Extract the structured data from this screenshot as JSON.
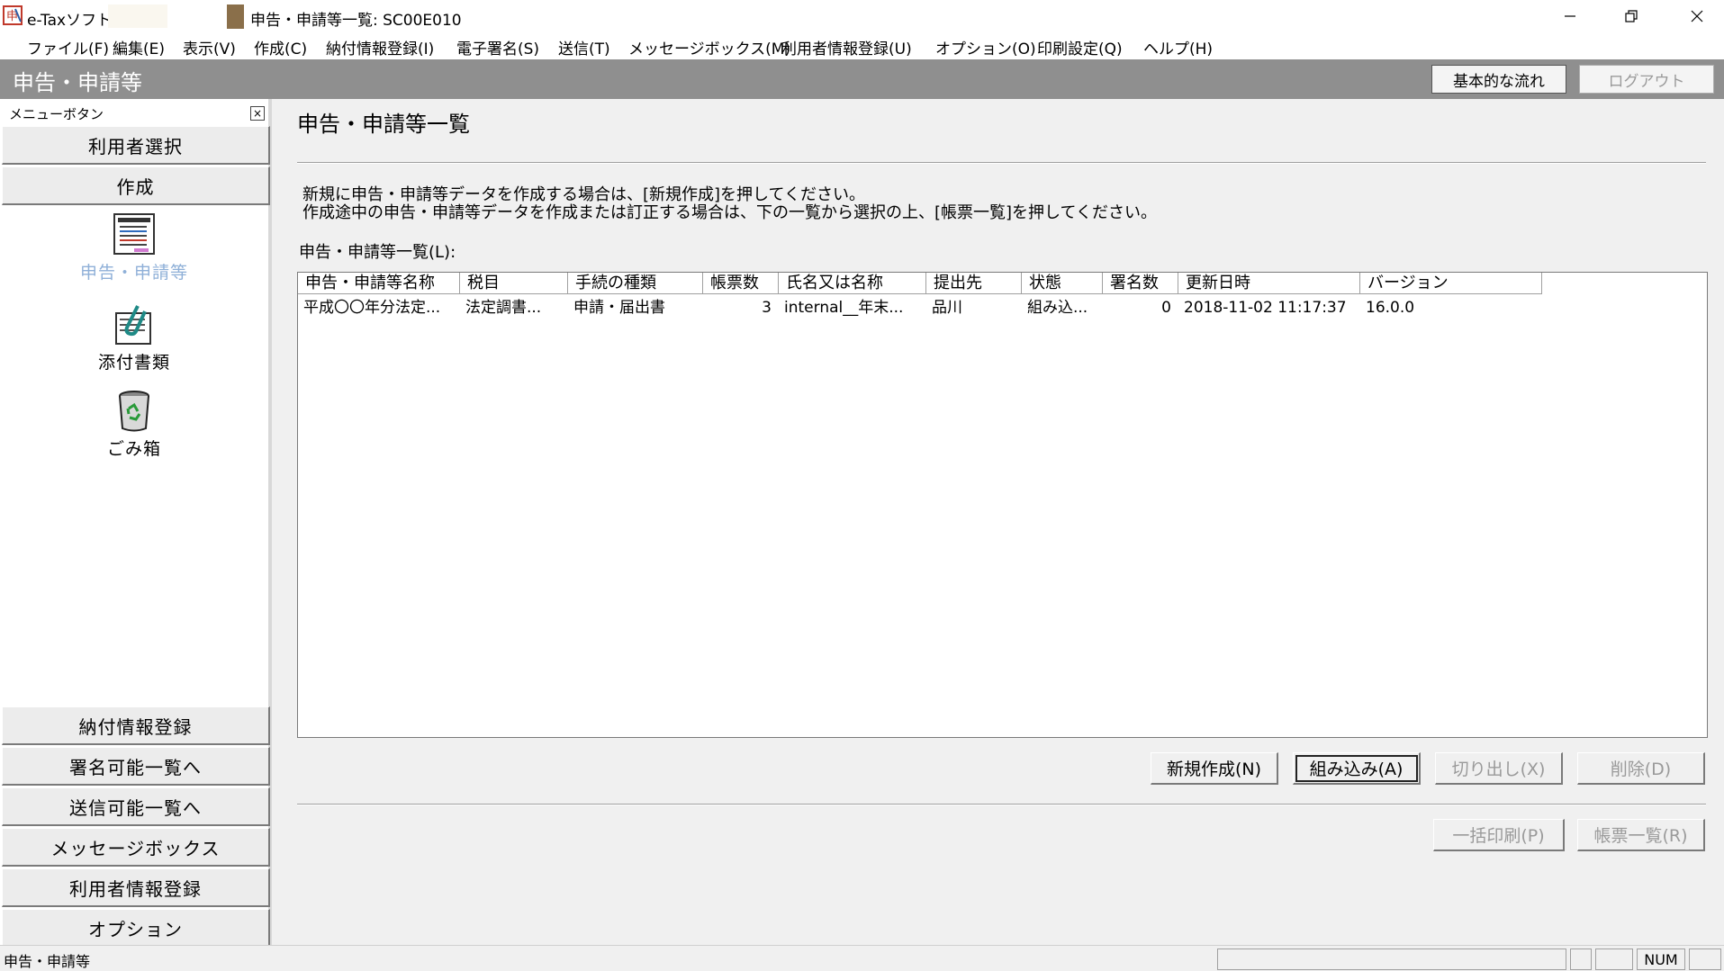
{
  "window": {
    "app_title": "e-Taxソフト -",
    "doc_title": "申告・申請等一覧: SC00E010"
  },
  "menubar": {
    "items": [
      "ファイル(F)",
      "編集(E)",
      "表示(V)",
      "作成(C)",
      "納付情報登録(I)",
      "電子署名(S)",
      "送信(T)",
      "メッセージボックス(M)",
      "利用者情報登録(U)",
      "オプション(O)",
      "印刷設定(Q)",
      "ヘルプ(H)"
    ]
  },
  "header": {
    "title": "申告・申請等",
    "flow_button": "基本的な流れ",
    "logout_button": "ログアウト"
  },
  "sidebar": {
    "heading": "メニューボタン",
    "close_glyph": "×",
    "top_buttons": [
      "利用者選択",
      "作成"
    ],
    "icons": [
      {
        "label": "申告・申請等",
        "icon": "document-list-icon",
        "active": true
      },
      {
        "label": "添付書類",
        "icon": "paperclip-icon",
        "active": false
      },
      {
        "label": "ごみ箱",
        "icon": "trash-icon",
        "active": false
      }
    ],
    "bottom_buttons": [
      "納付情報登録",
      "署名可能一覧へ",
      "送信可能一覧へ",
      "メッセージボックス",
      "利用者情報登録",
      "オプション"
    ],
    "active_color": "#8fb0d8"
  },
  "main": {
    "title": "申告・申請等一覧",
    "instructions": [
      "新規に申告・申請等データを作成する場合は、[新規作成]を押してください。",
      "作成途中の申告・申請等データを作成または訂正する場合は、下の一覧から選択の上、[帳票一覧]を押してください。"
    ],
    "list_label": "申告・申請等一覧(L):",
    "table": {
      "columns": [
        "申告・申請等名称",
        "税目",
        "手続の種類",
        "帳票数",
        "氏名又は名称",
        "提出先",
        "状態",
        "署名数",
        "更新日時",
        "バージョン"
      ],
      "rows": [
        [
          "平成〇〇年分法定...",
          "法定調書...",
          "申請・届出書",
          "3",
          "internal__年末...",
          "品川",
          "組み込...",
          "0",
          "2018-11-02 11:17:37",
          "16.0.0"
        ]
      ]
    },
    "buttons": {
      "new": "新規作成(N)",
      "import": "組み込み(A)",
      "cut": "切り出し(X)",
      "delete": "削除(D)",
      "batch_print": "一括印刷(P)",
      "form_list": "帳票一覧(R)"
    }
  },
  "statusbar": {
    "text": "申告・申請等",
    "num": "NUM"
  }
}
